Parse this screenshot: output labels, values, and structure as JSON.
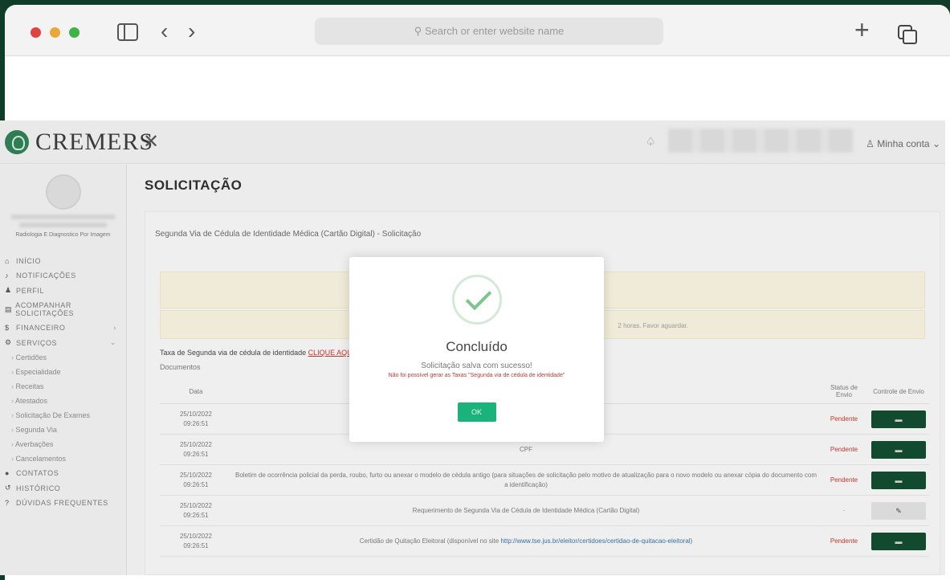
{
  "browser": {
    "url_placeholder": "Search or enter website name"
  },
  "site": {
    "logo_text": "CREMERS",
    "account_label": "Minha conta",
    "specialty": "Radiologia E Diagnostico Por Imagem"
  },
  "sidebar": {
    "items": [
      {
        "label": "INÍCIO",
        "icon": "home-icon"
      },
      {
        "label": "NOTIFICAÇÕES",
        "icon": "bell-icon"
      },
      {
        "label": "PERFIL",
        "icon": "user-icon"
      },
      {
        "label": "ACOMPANHAR SOLICITAÇÕES",
        "icon": "clipboard-icon"
      },
      {
        "label": "FINANCEIRO",
        "icon": "dollar-icon"
      },
      {
        "label": "SERVIÇOS",
        "icon": "cogs-icon"
      }
    ],
    "sub_items": [
      "Certidões",
      "Especialidade",
      "Receitas",
      "Atestados",
      "Solicitação De Exames",
      "Segunda Via",
      "Averbações",
      "Cancelamentos"
    ],
    "bottom_items": [
      {
        "label": "CONTATOS",
        "icon": "chat-icon"
      },
      {
        "label": "HISTÓRICO",
        "icon": "history-icon"
      },
      {
        "label": "DÚVIDAS FREQUENTES",
        "icon": "question-icon"
      }
    ]
  },
  "main": {
    "title": "SOLICITAÇÃO",
    "card_header": "Segunda Via de Cédula de Identidade Médica (Cartão Digital) - Solicitação",
    "warning_text": "2 horas. Favor aguardar.",
    "tax_label": "Taxa de Segunda via de cédula de identidade",
    "tax_link": "CLIQUE AQUI",
    "documents_label": "Documentos",
    "table": {
      "headers": [
        "Data",
        "",
        "Status de Envio",
        "Controle de Envio"
      ],
      "rows": [
        {
          "date": "25/10/2022",
          "time": "09:26:51",
          "doc": "",
          "status": "Pendente",
          "action": "upload"
        },
        {
          "date": "25/10/2022",
          "time": "09:26:51",
          "doc": "CPF",
          "status": "Pendente",
          "action": "upload"
        },
        {
          "date": "25/10/2022",
          "time": "09:26:51",
          "doc": "Boletim de ocorrência policial da perda, roubo, furto ou anexar o modelo de cédula antigo (para situações de solicitação pelo motivo de atualização para o novo modelo ou anexar cópia do documento com a identificação)",
          "status": "Pendente",
          "action": "upload"
        },
        {
          "date": "25/10/2022",
          "time": "09:26:51",
          "doc": "Requerimento de Segunda Via de Cédula de Identidade Médica (Cartão Digital)",
          "status": "-",
          "action": "edit"
        },
        {
          "date": "25/10/2022",
          "time": "09:26:51",
          "doc": "Certidão de Quitação Eleitoral (disponível no site",
          "doc_link": "http://www.tse.jus.br/eleitor/certidoes/certidao-de-quitacao-eleitoral)",
          "status": "Pendente",
          "action": "upload"
        }
      ]
    }
  },
  "modal": {
    "title": "Concluído",
    "message": "Solicitação salva com sucesso!",
    "error": "Não foi possível gerar as Taxas \"Segunda via de cédula de identidade\"",
    "ok_label": "OK"
  },
  "colors": {
    "brand_green": "#114a2e",
    "ok_green": "#1bb37c",
    "error_red": "#c0392b"
  }
}
